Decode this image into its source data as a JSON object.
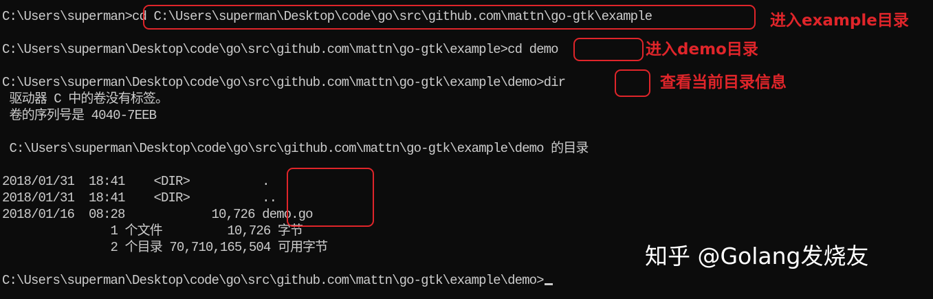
{
  "terminal": {
    "lines": [
      "C:\\Users\\superman>cd C:\\Users\\superman\\Desktop\\code\\go\\src\\github.com\\mattn\\go-gtk\\example",
      "",
      "C:\\Users\\superman\\Desktop\\code\\go\\src\\github.com\\mattn\\go-gtk\\example>cd demo",
      "",
      "C:\\Users\\superman\\Desktop\\code\\go\\src\\github.com\\mattn\\go-gtk\\example\\demo>dir",
      " 驱动器 C 中的卷没有标签。",
      " 卷的序列号是 4040-7EEB",
      "",
      " C:\\Users\\superman\\Desktop\\code\\go\\src\\github.com\\mattn\\go-gtk\\example\\demo 的目录",
      "",
      "2018/01/31  18:41    <DIR>          .",
      "2018/01/31  18:41    <DIR>          ..",
      "2018/01/16  08:28            10,726 demo.go",
      "               1 个文件         10,726 字节",
      "               2 个目录 70,710,165,504 可用字节",
      "",
      "C:\\Users\\superman\\Desktop\\code\\go\\src\\github.com\\mattn\\go-gtk\\example\\demo>"
    ]
  },
  "annotations": {
    "enter_example": "进入example目录",
    "enter_demo": "进入demo目录",
    "view_dir": "查看当前目录信息"
  },
  "watermark": "知乎 @Golang发烧友",
  "colors": {
    "background": "#0c0c0c",
    "text": "#cccccc",
    "annotation": "#e0252a",
    "watermark": "#ffffff"
  }
}
